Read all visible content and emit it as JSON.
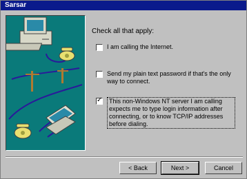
{
  "window": {
    "title": "Sarsar"
  },
  "heading": "Check all that apply:",
  "options": [
    {
      "label": "I am calling the Internet.",
      "checked": false
    },
    {
      "label": "Send my plain text password if that's the only way to connect.",
      "checked": false
    },
    {
      "label": "This non-Windows NT server I am calling expects me to type login information after connecting, or to know TCP/IP addresses before dialing.",
      "checked": true
    }
  ],
  "buttons": {
    "back": "< Back",
    "next": "Next >",
    "cancel": "Cancel"
  },
  "illustration": {
    "background": "#0a7a7a",
    "icons": [
      "computer-icon",
      "telephone-icon",
      "telephone-pole-icon",
      "telephone-icon",
      "laptop-icon"
    ]
  }
}
